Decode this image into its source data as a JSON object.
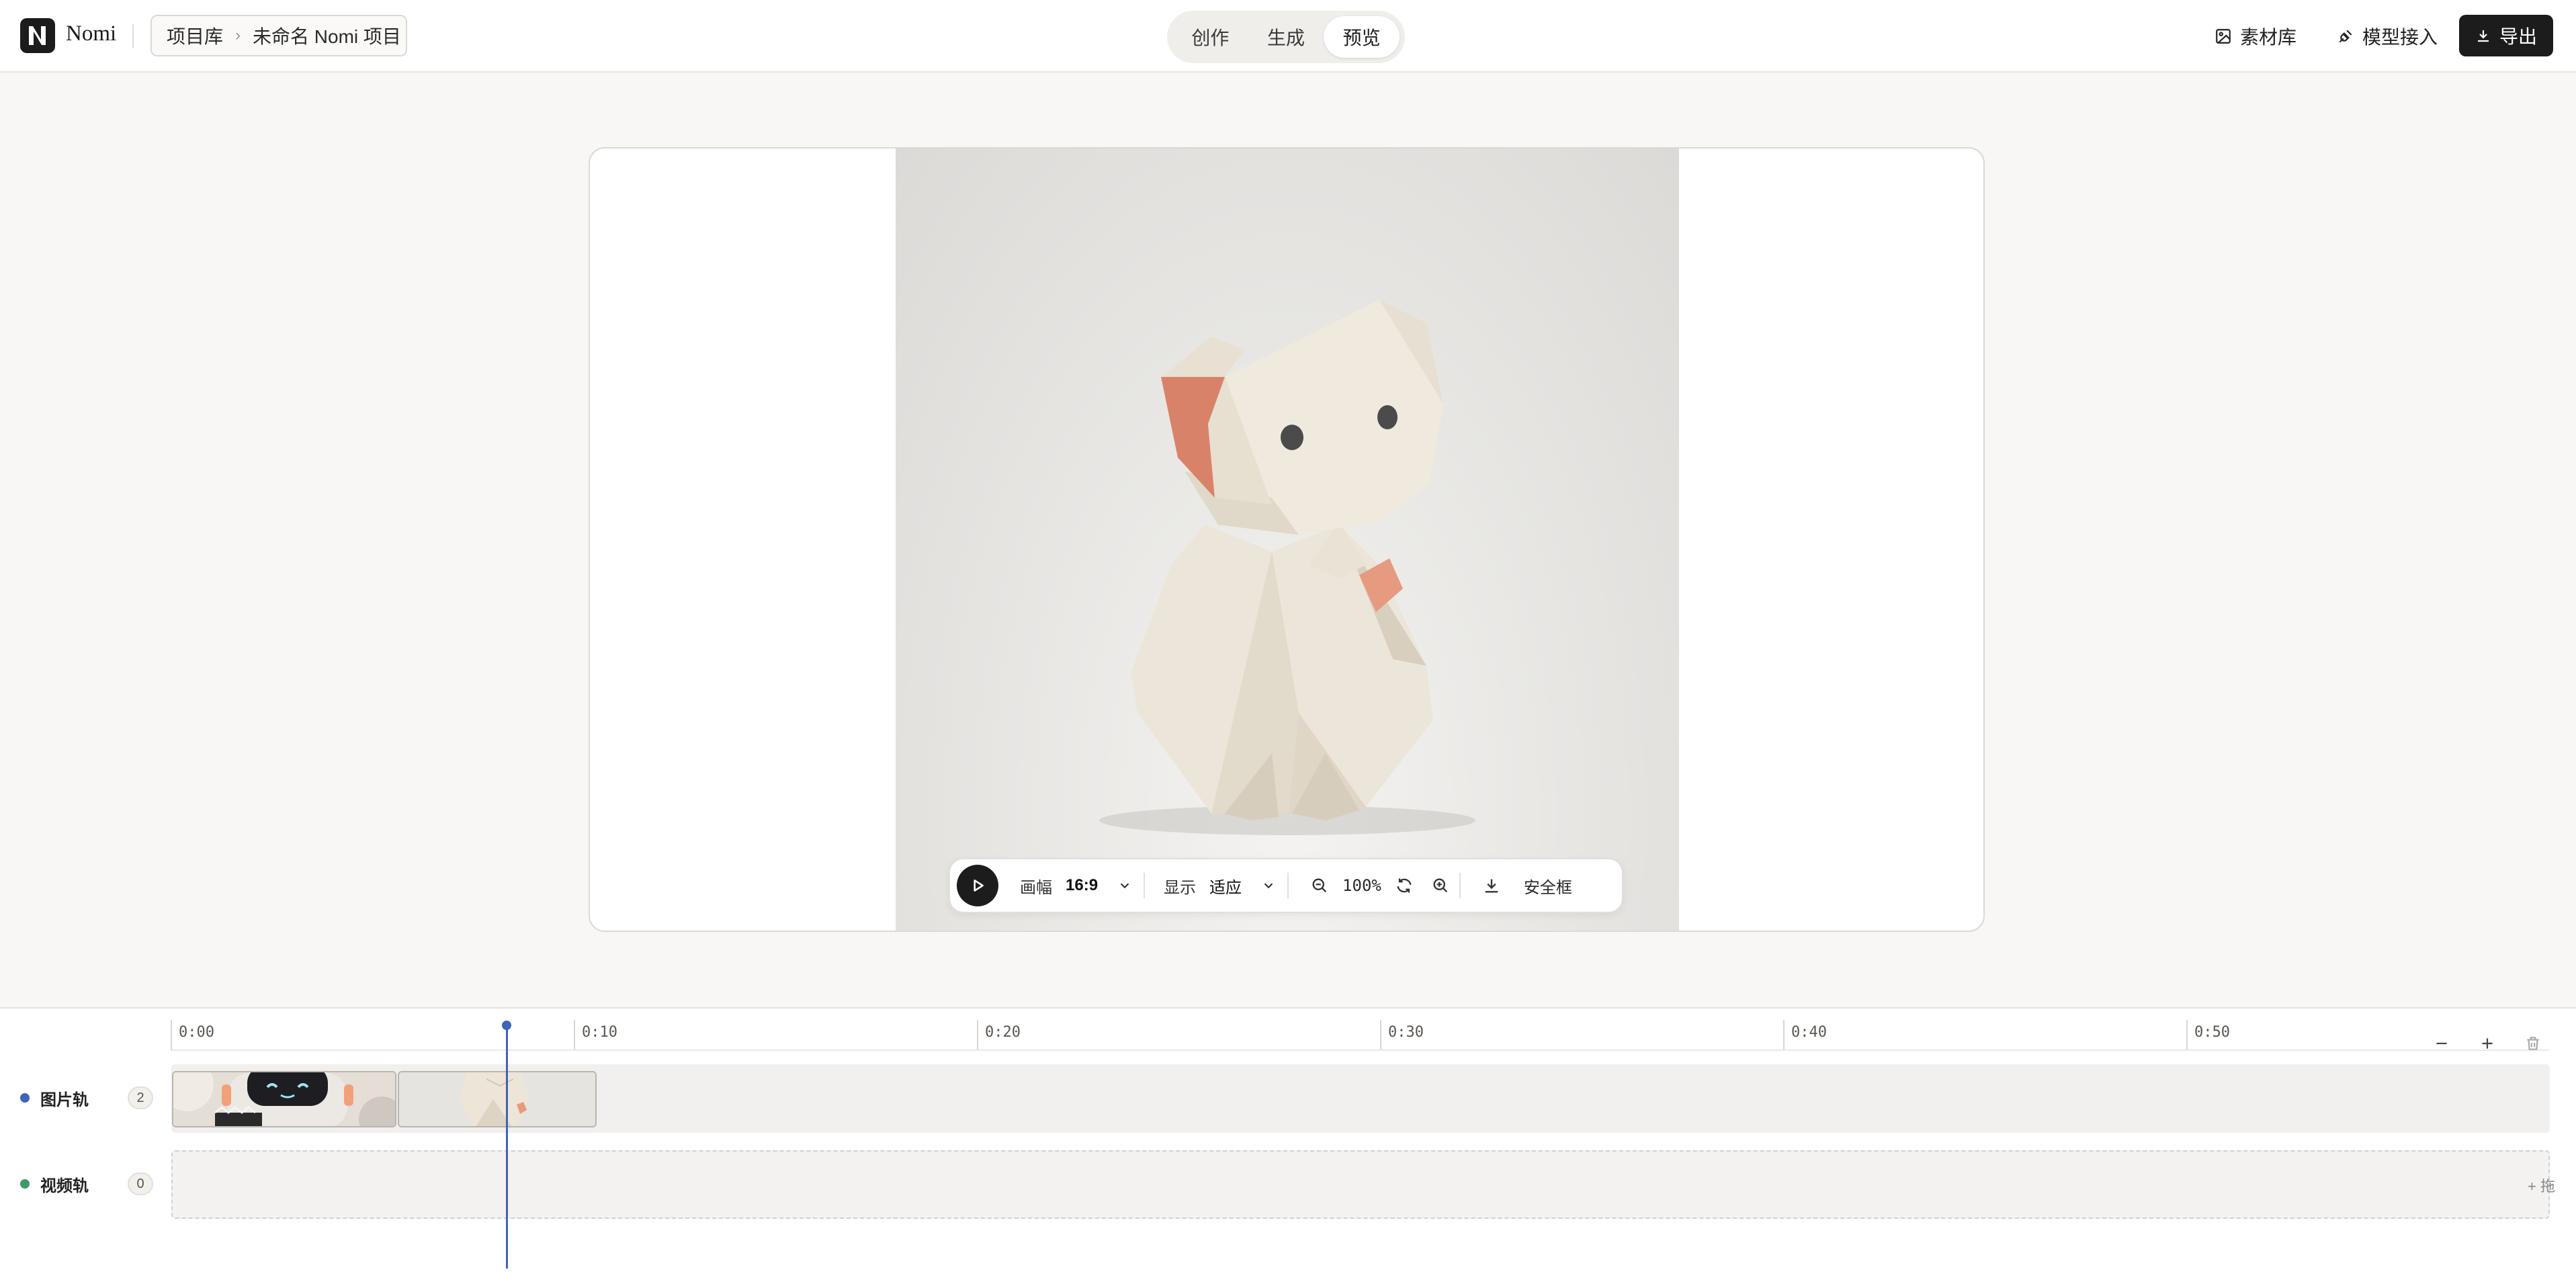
{
  "header": {
    "logo_mark": "N",
    "app_name": "Nomi",
    "breadcrumb": {
      "root": "项目库",
      "separator": "›",
      "current": "未命名 Nomi 项目"
    },
    "mode_tabs": [
      {
        "label": "创作",
        "active": false
      },
      {
        "label": "生成",
        "active": false
      },
      {
        "label": "预览",
        "active": true
      }
    ],
    "actions": {
      "assets_label": "素材库",
      "model_label": "模型接入",
      "export_label": "导出"
    }
  },
  "preview": {
    "controls": {
      "canvas_label": "画幅",
      "canvas_value": "16:9",
      "display_label": "显示",
      "display_value": "适应",
      "zoom_value": "100%",
      "safe_frame_label": "安全框"
    }
  },
  "timeline": {
    "ruler_ticks": [
      "0:00",
      "0:10",
      "0:20",
      "0:30",
      "0:40",
      "0:50"
    ],
    "tracks": [
      {
        "label": "图片轨",
        "count": "2",
        "color": "#3e63b8"
      },
      {
        "label": "视频轨",
        "count": "0",
        "color": "#3d9a6c"
      }
    ],
    "add_hint": "+ 拖"
  },
  "colors": {
    "accent": "#1c1c1c",
    "playhead": "#3e63b8",
    "image_track": "#3e63b8",
    "video_track": "#3d9a6c"
  },
  "icons": {
    "assets": "image-icon",
    "model": "plug-icon",
    "export": "download-icon",
    "play": "play-icon",
    "zoom_out": "zoom-out-icon",
    "reset": "refresh-icon",
    "zoom_in": "zoom-in-icon",
    "download": "download-icon",
    "timeline_minus": "minus-icon",
    "timeline_plus": "plus-icon",
    "timeline_delete": "trash-icon"
  }
}
